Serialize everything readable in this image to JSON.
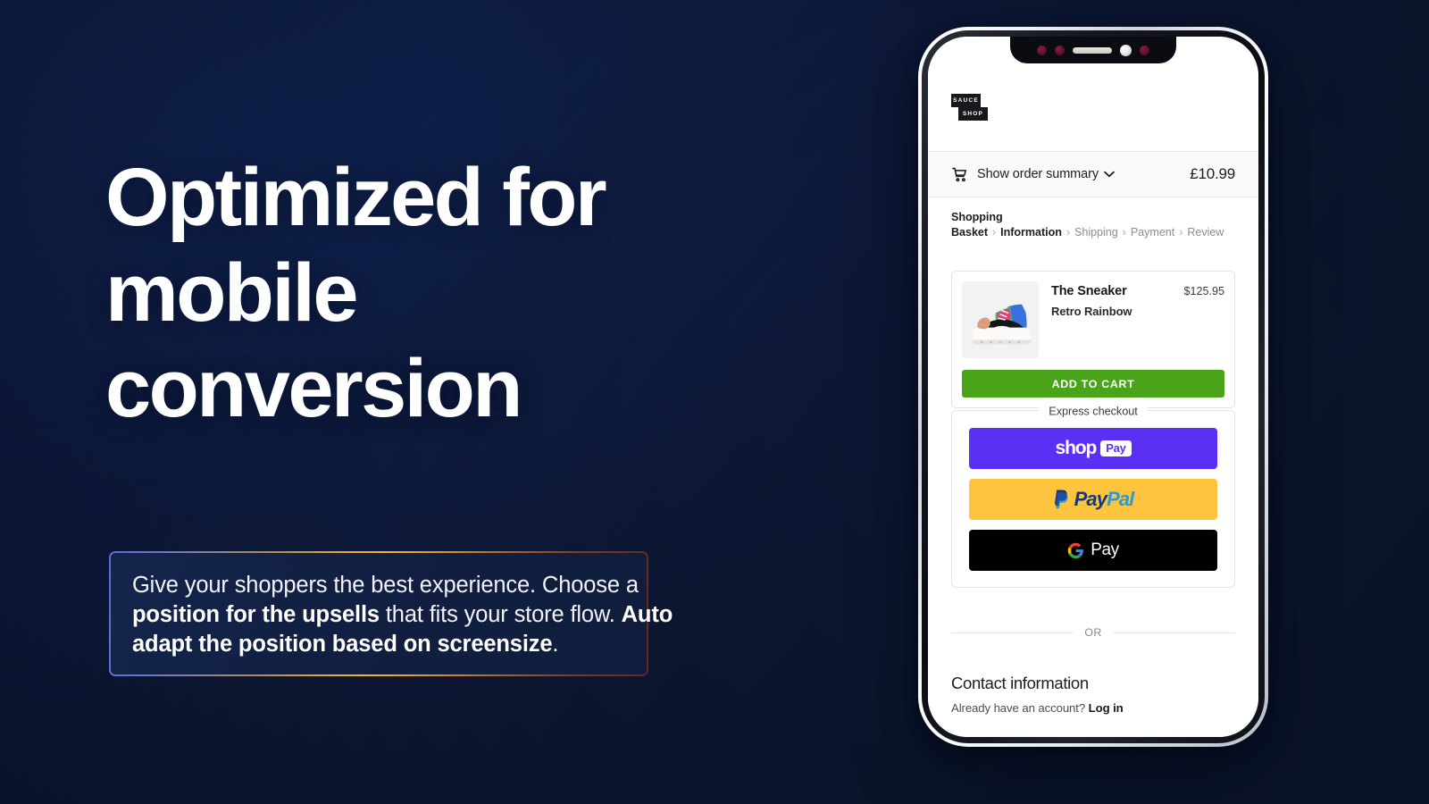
{
  "hero": {
    "headline": "Optimized for mobile conversion",
    "callout": {
      "line1_a": "Give your shoppers the best experience. Choose a",
      "line2_bold": "position for the upsells",
      "line2_mid": " that fits your store flow. ",
      "line2_bold2": "Auto",
      "line3_bold": "adapt the position based on screensize",
      "line3_end": "."
    }
  },
  "phone": {
    "brand": {
      "line1": "SAUCE",
      "line2": "SHOP"
    },
    "order_bar": {
      "icon": "shopping-cart-icon",
      "label": "Show order summary",
      "chevron": "chevron-down-icon",
      "total": "£10.99"
    },
    "breadcrumbs": [
      {
        "label": "Shopping Basket",
        "active": true
      },
      {
        "label": "Information",
        "active": true
      },
      {
        "label": "Shipping",
        "active": false
      },
      {
        "label": "Payment",
        "active": false
      },
      {
        "label": "Review",
        "active": false
      }
    ],
    "breadcrumb_separator": "›",
    "product": {
      "title": "The Sneaker",
      "variant": "Retro Rainbow",
      "price": "$125.95",
      "add_to_cart": "ADD TO CART",
      "add_to_cart_color": "#4aa419"
    },
    "express": {
      "legend": "Express checkout",
      "buttons": [
        {
          "name": "shop-pay",
          "text_a": "shop",
          "text_b": "Pay",
          "bg": "#5a31f4"
        },
        {
          "name": "paypal",
          "text_a": "Pay",
          "text_b": "Pal",
          "bg": "#ffc43d"
        },
        {
          "name": "google-pay",
          "text_a": "G",
          "text_b": "Pay",
          "bg": "#000000"
        }
      ]
    },
    "or_divider": "OR",
    "contact": {
      "heading": "Contact information",
      "sub_text": "Already have an account? ",
      "login_link": "Log in"
    }
  },
  "colors": {
    "bg_start": "#1c3f97",
    "bg_end": "#0b1429",
    "callout_border_start": "#5b6ddb",
    "callout_border_mid": "#f5b427",
    "callout_border_end": "#5d2a24",
    "shop_pay": "#5a31f4",
    "paypal": "#ffc43d",
    "google_pay": "#000000",
    "add_to_cart": "#4aa419"
  }
}
